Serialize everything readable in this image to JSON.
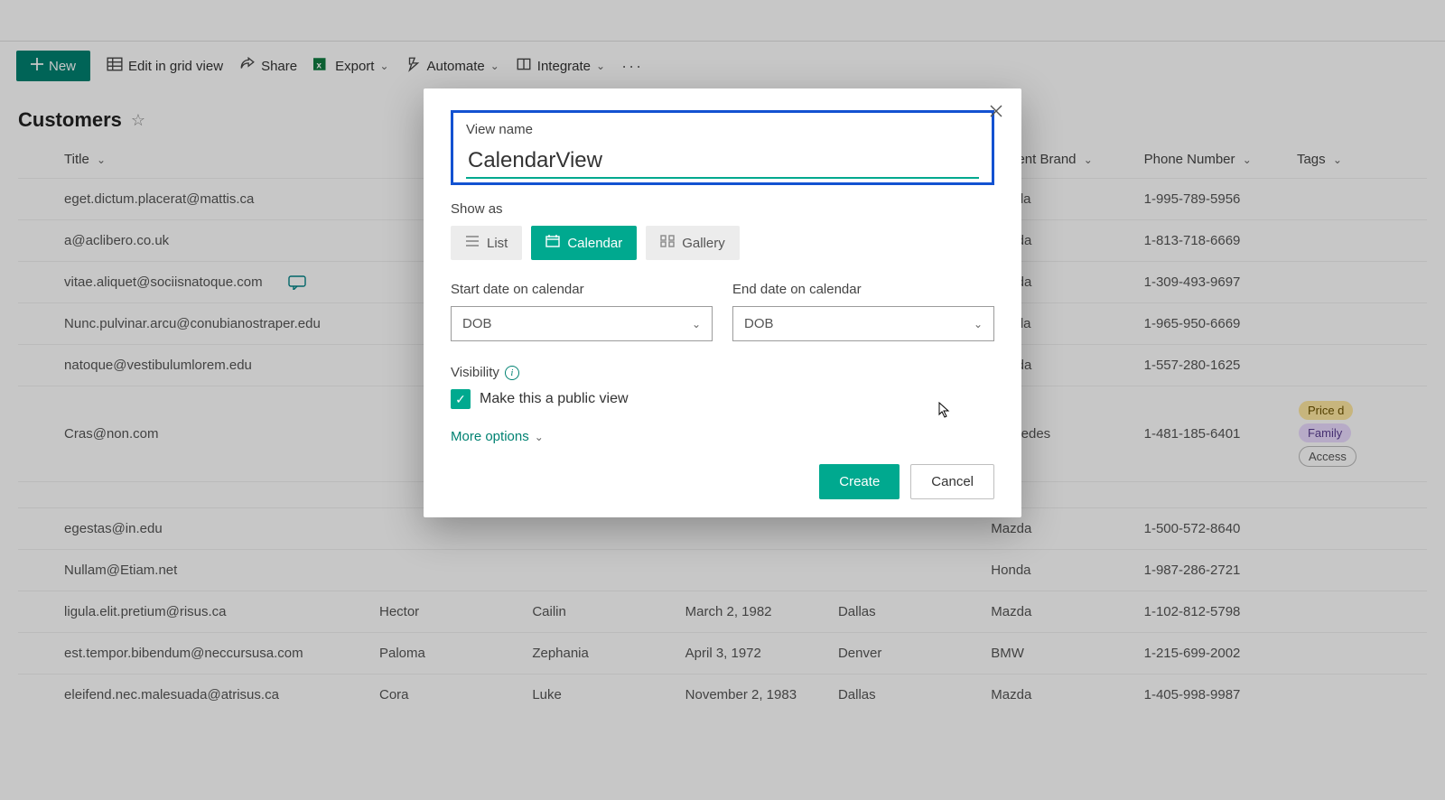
{
  "toolbar": {
    "new_label": "New",
    "edit_grid_label": "Edit in grid view",
    "share_label": "Share",
    "export_label": "Export",
    "automate_label": "Automate",
    "integrate_label": "Integrate"
  },
  "page": {
    "title": "Customers"
  },
  "columns": {
    "title": "Title",
    "current_brand": "Current Brand",
    "phone": "Phone Number",
    "tags": "Tags"
  },
  "rows": [
    {
      "title": "eget.dictum.placerat@mattis.ca",
      "first": "",
      "last": "",
      "dob": "",
      "city": "",
      "brand": "Honda",
      "phone": "1-995-789-5956",
      "tags": ""
    },
    {
      "title": "a@aclibero.co.uk",
      "first": "",
      "last": "",
      "dob": "",
      "city": "",
      "brand": "Mazda",
      "phone": "1-813-718-6669",
      "tags": ""
    },
    {
      "title": "vitae.aliquet@sociisnatoque.com",
      "first": "",
      "last": "",
      "dob": "",
      "city": "",
      "brand": "Mazda",
      "phone": "1-309-493-9697",
      "tags": "",
      "has_comment": true
    },
    {
      "title": "Nunc.pulvinar.arcu@conubianostraper.edu",
      "first": "",
      "last": "",
      "dob": "",
      "city": "",
      "brand": "Honda",
      "phone": "1-965-950-6669",
      "tags": ""
    },
    {
      "title": "natoque@vestibulumlorem.edu",
      "first": "",
      "last": "",
      "dob": "",
      "city": "",
      "brand": "Mazda",
      "phone": "1-557-280-1625",
      "tags": ""
    },
    {
      "title": "Cras@non.com",
      "first": "",
      "last": "",
      "dob": "",
      "city": "",
      "brand": "Mercedes",
      "phone": "1-481-185-6401",
      "tags": "Price d|Family|Access"
    },
    {
      "title": "",
      "first": "",
      "last": "",
      "dob": "",
      "city": "",
      "brand": "",
      "phone": "",
      "tags": ""
    },
    {
      "title": "egestas@in.edu",
      "first": "",
      "last": "",
      "dob": "",
      "city": "",
      "brand": "Mazda",
      "phone": "1-500-572-8640",
      "tags": ""
    },
    {
      "title": "Nullam@Etiam.net",
      "first": "",
      "last": "",
      "dob": "",
      "city": "",
      "brand": "Honda",
      "phone": "1-987-286-2721",
      "tags": ""
    },
    {
      "title": "ligula.elit.pretium@risus.ca",
      "first": "Hector",
      "last": "Cailin",
      "dob": "March 2, 1982",
      "city": "Dallas",
      "brand": "Mazda",
      "phone": "1-102-812-5798",
      "tags": ""
    },
    {
      "title": "est.tempor.bibendum@neccursusa.com",
      "first": "Paloma",
      "last": "Zephania",
      "dob": "April 3, 1972",
      "city": "Denver",
      "brand": "BMW",
      "phone": "1-215-699-2002",
      "tags": ""
    },
    {
      "title": "eleifend.nec.malesuada@atrisus.ca",
      "first": "Cora",
      "last": "Luke",
      "dob": "November 2, 1983",
      "city": "Dallas",
      "brand": "Mazda",
      "phone": "1-405-998-9987",
      "tags": ""
    }
  ],
  "dialog": {
    "view_name_label": "View name",
    "view_name_value": "CalendarView",
    "show_as_label": "Show as",
    "showas_list": "List",
    "showas_calendar": "Calendar",
    "showas_gallery": "Gallery",
    "start_date_label": "Start date on calendar",
    "end_date_label": "End date on calendar",
    "start_date_value": "DOB",
    "end_date_value": "DOB",
    "visibility_label": "Visibility",
    "public_view_label": "Make this a public view",
    "more_options_label": "More options",
    "create_label": "Create",
    "cancel_label": "Cancel"
  }
}
